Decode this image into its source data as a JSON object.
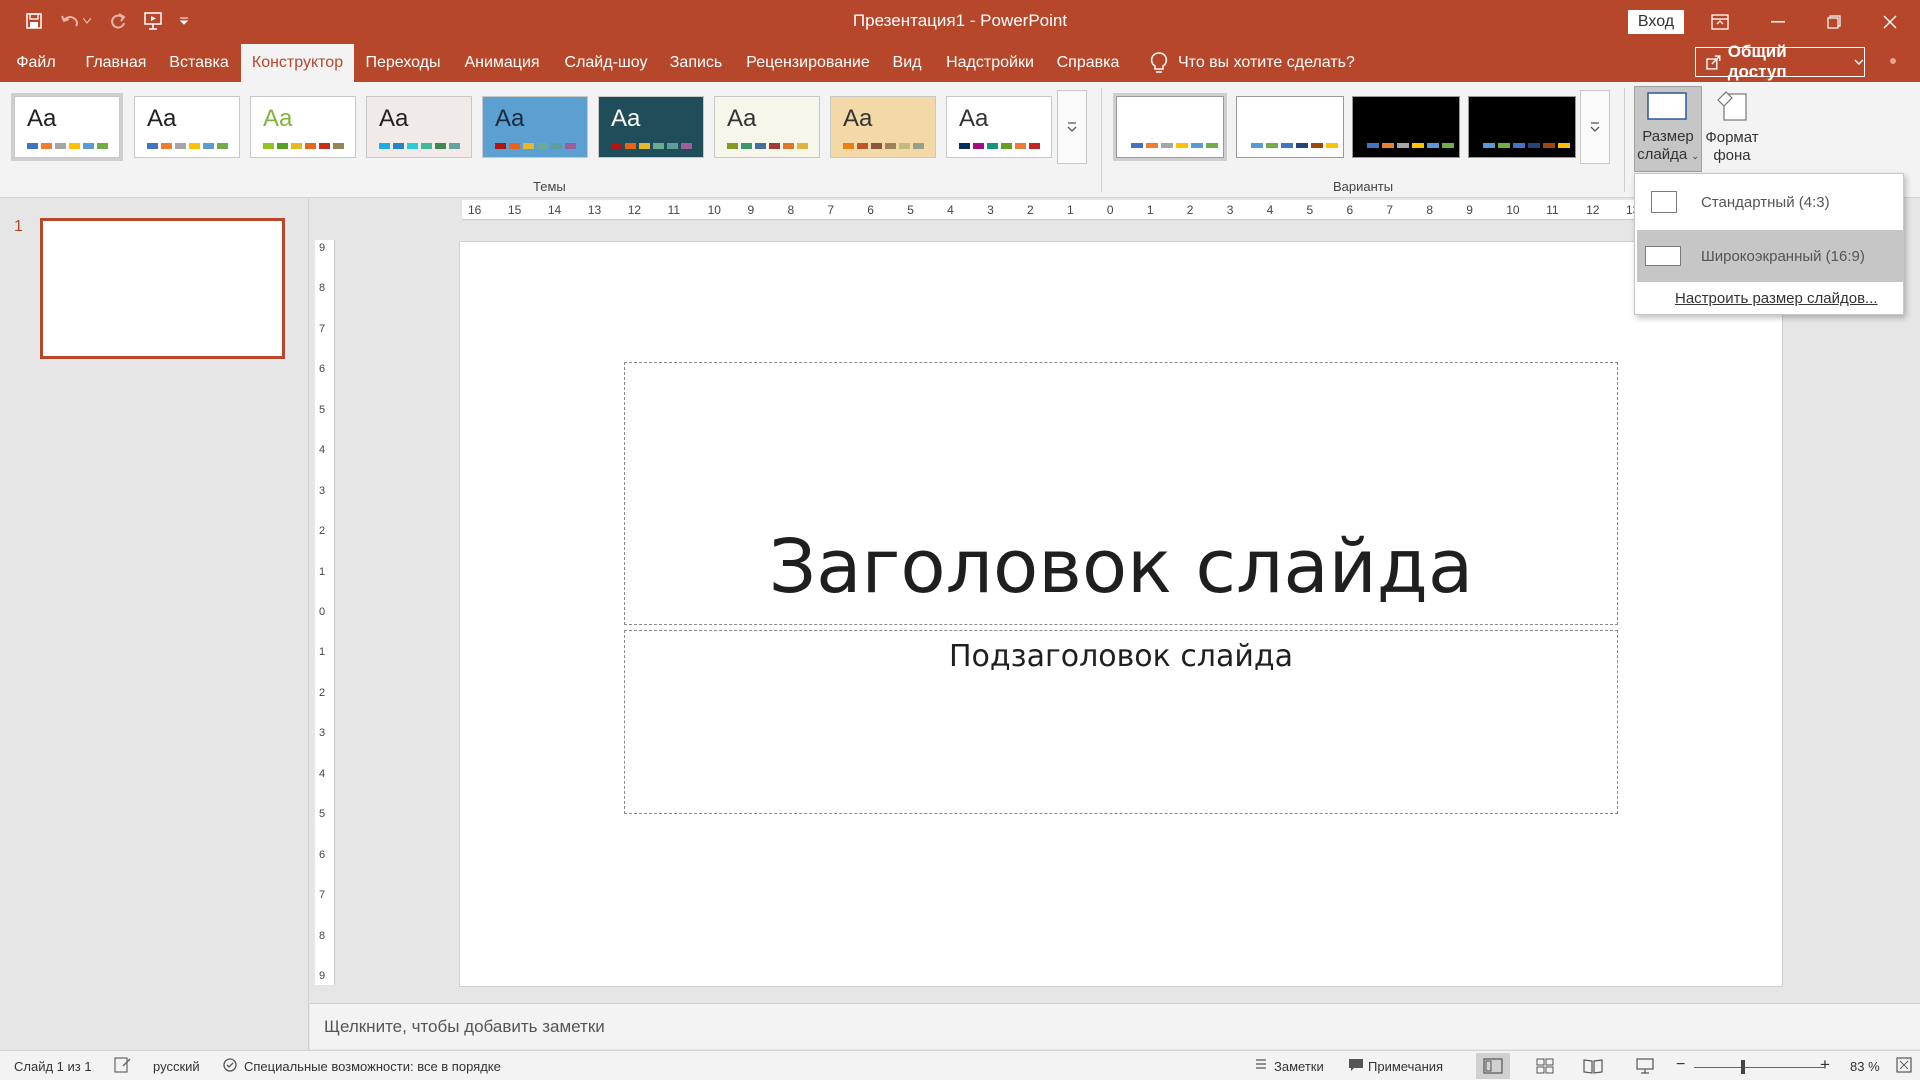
{
  "window": {
    "title": "Презентация1  -  PowerPoint",
    "signin_label": "Вход"
  },
  "quick_access": {
    "icons": [
      "save-icon",
      "undo-icon",
      "redo-icon",
      "start-from-beginning-icon",
      "customize-qat-icon"
    ]
  },
  "tabs": [
    {
      "label": "Файл",
      "active": false
    },
    {
      "label": "Главная",
      "active": false
    },
    {
      "label": "Вставка",
      "active": false
    },
    {
      "label": "Конструктор",
      "active": true
    },
    {
      "label": "Переходы",
      "active": false
    },
    {
      "label": "Анимация",
      "active": false
    },
    {
      "label": "Слайд-шоу",
      "active": false
    },
    {
      "label": "Запись",
      "active": false
    },
    {
      "label": "Рецензирование",
      "active": false
    },
    {
      "label": "Вид",
      "active": false
    },
    {
      "label": "Надстройки",
      "active": false
    },
    {
      "label": "Справка",
      "active": false
    }
  ],
  "tell_me": {
    "placeholder": "Что вы хотите сделать?"
  },
  "share_label": "Общий доступ",
  "ribbon": {
    "themes_group_label": "Темы",
    "variants_group_label": "Варианты",
    "theme_sample_text": "Aa",
    "slide_size_label_1": "Размер",
    "slide_size_label_2": "слайда",
    "format_bg_label_1": "Формат",
    "format_bg_label_2": "фона",
    "themes": [
      {
        "name": "Office Theme",
        "bg": "#ffffff",
        "text": "#222222",
        "colors": [
          "#4472c4",
          "#ed7d31",
          "#a5a5a5",
          "#ffc000",
          "#5b9bd5",
          "#70ad47"
        ]
      },
      {
        "name": "Office 2013",
        "bg": "#ffffff",
        "text": "#222222",
        "colors": [
          "#4472c4",
          "#ed7d31",
          "#a5a5a5",
          "#ffc000",
          "#5b9bd5",
          "#70ad47"
        ]
      },
      {
        "name": "Facet",
        "bg": "#ffffff",
        "text": "#83b43a",
        "colors": [
          "#90c226",
          "#54a021",
          "#e6b91e",
          "#e76618",
          "#c42f1a",
          "#918655"
        ]
      },
      {
        "name": "Integral",
        "bg": "#f0ebe8",
        "text": "#222222",
        "colors": [
          "#1cade4",
          "#2683c6",
          "#27ced7",
          "#42ba97",
          "#3e8853",
          "#62a39f"
        ]
      },
      {
        "name": "Ion Boardroom",
        "bg": "#5ba0d0",
        "text": "#1a2a40",
        "colors": [
          "#b01513",
          "#ea6312",
          "#e6b729",
          "#6aac90",
          "#5f9c9d",
          "#9e5e9b"
        ]
      },
      {
        "name": "Ion",
        "bg": "#1f4e5a",
        "text": "#ffffff",
        "colors": [
          "#b01513",
          "#ea6312",
          "#e6b729",
          "#6aac90",
          "#5f9c9d",
          "#9e5e9b"
        ]
      },
      {
        "name": "Organic",
        "bg": "#f6f6ea",
        "text": "#333333",
        "colors": [
          "#83992a",
          "#3c9770",
          "#44709d",
          "#a23c33",
          "#d97828",
          "#deb340"
        ]
      },
      {
        "name": "Retrospect",
        "bg": "#f4d9a8",
        "text": "#333333",
        "colors": [
          "#e48312",
          "#bd582c",
          "#865640",
          "#9b8357",
          "#c2bc80",
          "#94a088"
        ]
      },
      {
        "name": "Slice",
        "bg": "#ffffff",
        "text": "#333333",
        "colors": [
          "#052f61",
          "#a50e82",
          "#14967c",
          "#6a9e1f",
          "#e87d37",
          "#c62324"
        ]
      }
    ],
    "variants": [
      {
        "bg": "#ffffff",
        "colors": [
          "#4472c4",
          "#ed7d31",
          "#a5a5a5",
          "#ffc000",
          "#5b9bd5",
          "#70ad47"
        ]
      },
      {
        "bg": "#ffffff",
        "colors": [
          "#5b9bd5",
          "#70ad47",
          "#4472c4",
          "#264478",
          "#9e480e",
          "#ffc000"
        ]
      },
      {
        "bg": "#000000",
        "colors": [
          "#4472c4",
          "#ed7d31",
          "#a5a5a5",
          "#ffc000",
          "#5b9bd5",
          "#70ad47"
        ]
      },
      {
        "bg": "#000000",
        "colors": [
          "#5b9bd5",
          "#70ad47",
          "#4472c4",
          "#264478",
          "#9e480e",
          "#ffc000"
        ]
      }
    ]
  },
  "slide_size_menu": {
    "standard": "Стандартный (4:3)",
    "widescreen": "Широкоэкранный (16:9)",
    "custom": "Настроить размер слайдов..."
  },
  "thumbnails": [
    {
      "number": "1"
    }
  ],
  "ruler": {
    "horizontal": [
      "16",
      "15",
      "14",
      "13",
      "12",
      "11",
      "10",
      "9",
      "8",
      "7",
      "6",
      "5",
      "4",
      "3",
      "2",
      "1",
      "0",
      "1",
      "2",
      "3",
      "4",
      "5",
      "6",
      "7",
      "8",
      "9",
      "10",
      "11",
      "12",
      "13"
    ],
    "vertical": [
      "9",
      "8",
      "7",
      "6",
      "5",
      "4",
      "3",
      "2",
      "1",
      "0",
      "1",
      "2",
      "3",
      "4",
      "5",
      "6",
      "7",
      "8",
      "9"
    ]
  },
  "slide": {
    "title": "Заголовок слайда",
    "subtitle": "Подзаголовок слайда"
  },
  "notes_placeholder": "Щелкните, чтобы добавить заметки",
  "status": {
    "slide_counter": "Слайд 1 из 1",
    "language": "русский",
    "accessibility": "Специальные возможности: все в порядке",
    "notes_label": "Заметки",
    "comments_label": "Примечания",
    "zoom": "83 %"
  },
  "colors": {
    "accent": "#b7472a"
  }
}
